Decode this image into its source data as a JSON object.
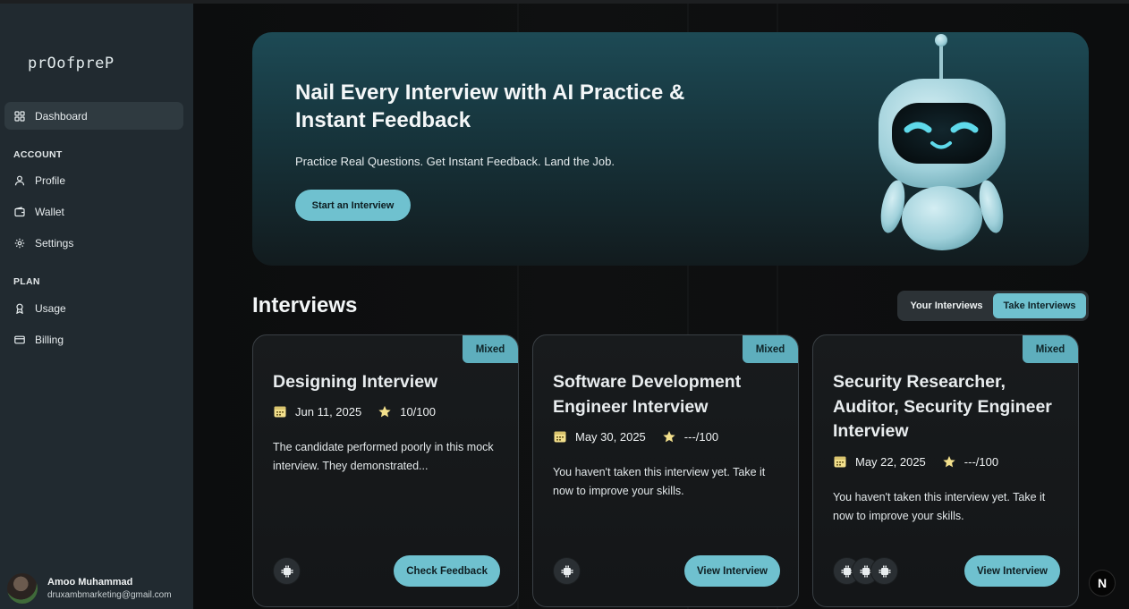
{
  "brand": {
    "logo_text": "prOofpreP"
  },
  "sidebar": {
    "dashboard": "Dashboard",
    "account_label": "ACCOUNT",
    "account_items": [
      "Profile",
      "Wallet",
      "Settings"
    ],
    "plan_label": "PLAN",
    "plan_items": [
      "Usage",
      "Billing"
    ]
  },
  "user": {
    "name": "Amoo Muhammad",
    "email": "druxambmarketing@gmail.com"
  },
  "hero": {
    "title": "Nail Every Interview with AI Practice & Instant Feedback",
    "subtitle": "Practice Real Questions. Get Instant Feedback. Land the Job.",
    "cta": "Start an Interview"
  },
  "interviews": {
    "title": "Interviews",
    "tabs": [
      "Your Interviews",
      "Take Interviews"
    ],
    "active_tab": "Take Interviews",
    "cards": [
      {
        "badge": "Mixed",
        "title": "Designing Interview",
        "date": "Jun 11, 2025",
        "score": "10/100",
        "desc": "The candidate performed poorly in this mock interview. They demonstrated...",
        "button": "Check Feedback",
        "tech_icons": 1
      },
      {
        "badge": "Mixed",
        "title": "Software Development Engineer Interview",
        "date": "May 30, 2025",
        "score": "---/100",
        "desc": "You haven't taken this interview yet. Take it now to improve your skills.",
        "button": "View Interview",
        "tech_icons": 1
      },
      {
        "badge": "Mixed",
        "title": "Security Researcher, Auditor, Security Engineer Interview",
        "date": "May 22, 2025",
        "score": "---/100",
        "desc": "You haven't taken this interview yet. Take it now to improve your skills.",
        "button": "View Interview",
        "tech_icons": 3
      }
    ]
  },
  "corner_badge": "N",
  "colors": {
    "accent": "#6fc1cf",
    "badge": "#5eaebd",
    "sidebar_bg": "#212a30",
    "star": "#f3e08c"
  },
  "icons": [
    "dashboard-icon",
    "user-icon",
    "wallet-icon",
    "gear-icon",
    "medal-icon",
    "card-icon",
    "calendar-icon",
    "star-icon",
    "tech-icon"
  ]
}
